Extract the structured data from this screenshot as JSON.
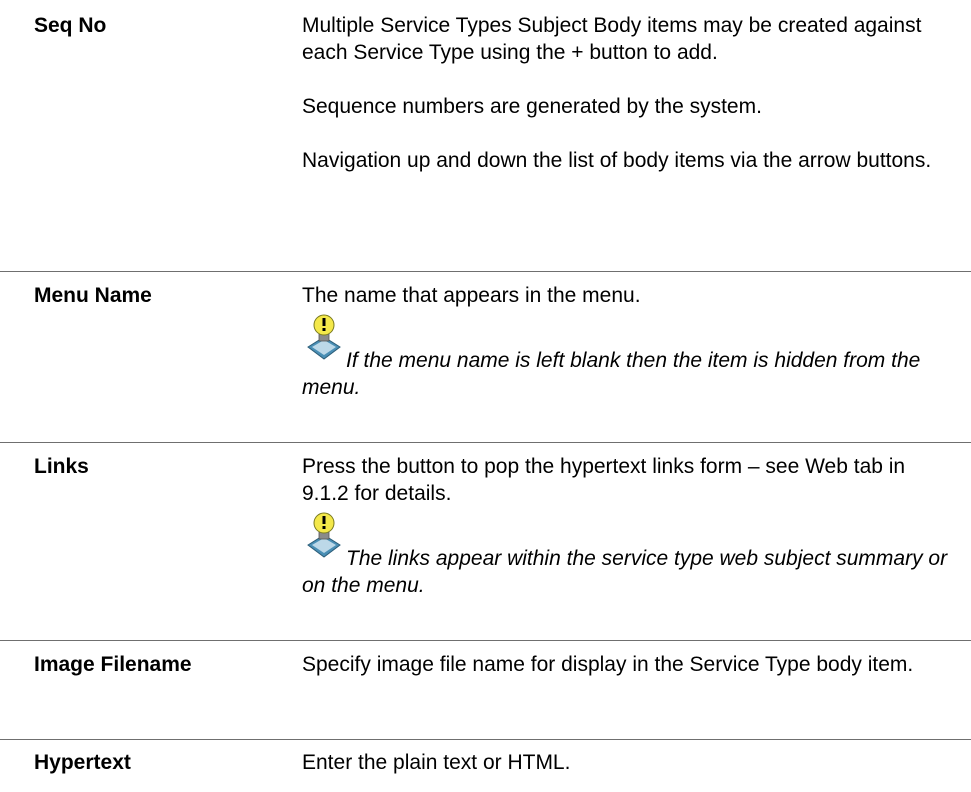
{
  "rows": [
    {
      "term": "Seq No",
      "paragraphs": [
        "Multiple Service Types Subject Body items may be created against each Service Type using the + button to add.",
        "Sequence numbers are generated by the system.",
        "Navigation up and down the list of body items via the arrow buttons."
      ]
    },
    {
      "term": "Menu Name",
      "paragraphs": [
        "The name that appears in the menu."
      ],
      "tip": "If the menu name is left blank then the item is hidden from the menu.",
      "tip_icon": "lightbulb-tip-icon"
    },
    {
      "term": "Links",
      "paragraphs": [
        "Press the button to pop the hypertext links form – see Web tab in 9.1.2 for details."
      ],
      "tip": "The links appear within the service type web subject  summary or on the menu.",
      "tip_icon": "lightbulb-tip-icon"
    },
    {
      "term": "Image Filename",
      "paragraphs": [
        "Specify image file name for display in the Service Type body item."
      ]
    },
    {
      "term": "Hypertext",
      "paragraphs": [
        "Enter the plain text or HTML."
      ]
    }
  ],
  "colors": {
    "rule": "#6f6f6f",
    "bulb": "#f4e84a",
    "stand": "#4a8fb5"
  }
}
